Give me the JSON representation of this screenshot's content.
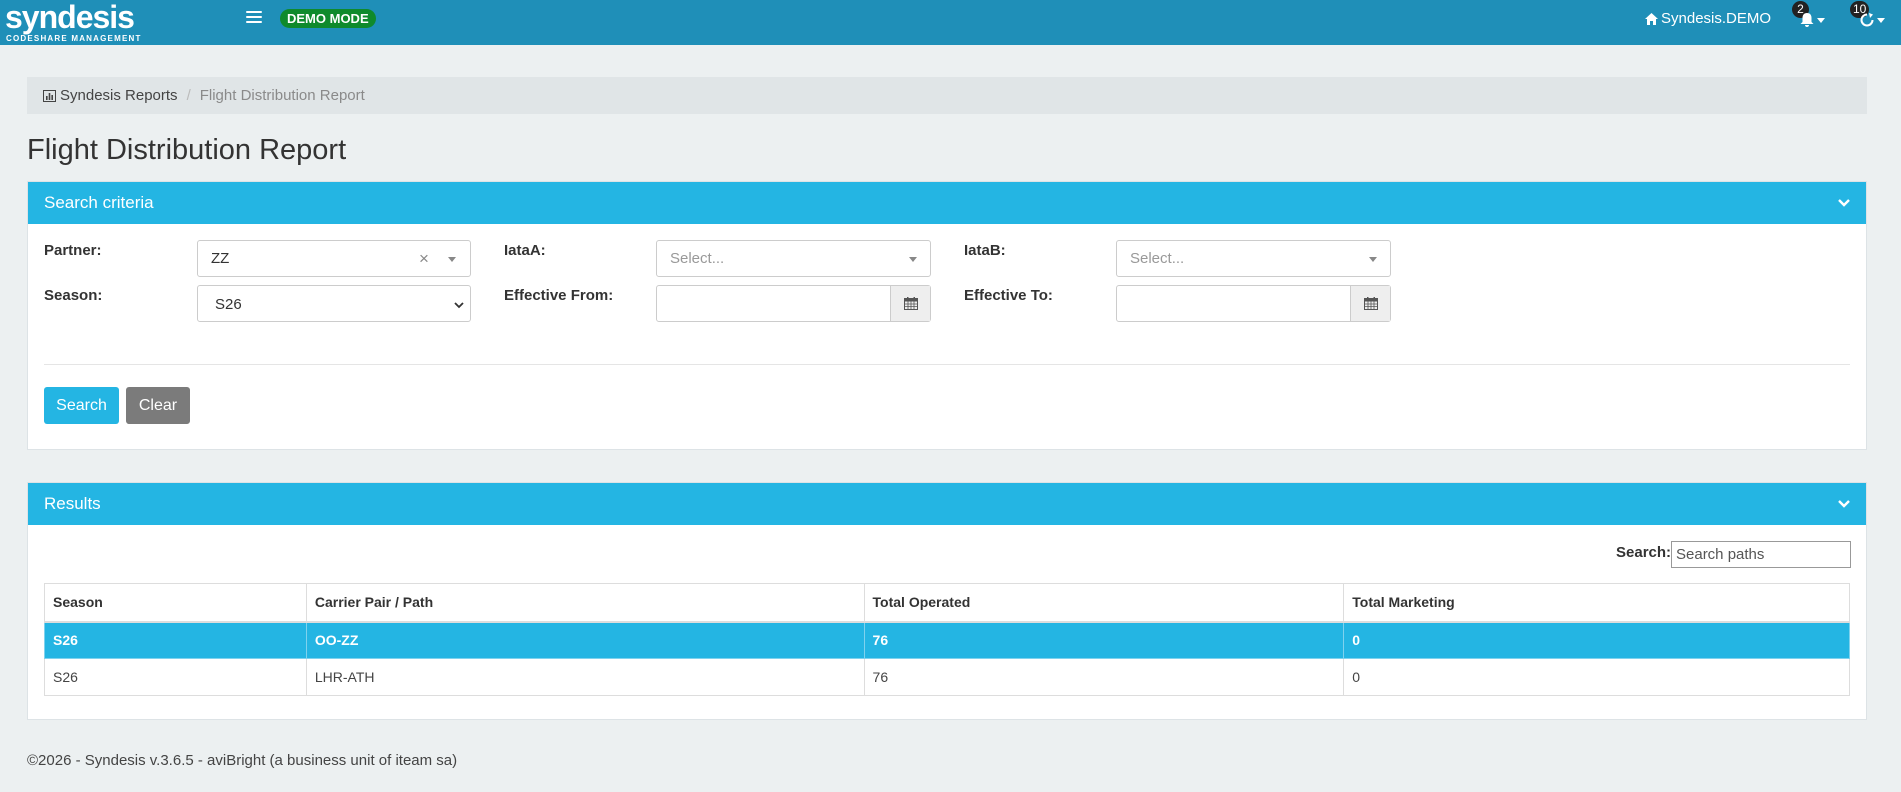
{
  "navbar": {
    "logo_main": "syndesis",
    "logo_sub": "CODESHARE MANAGEMENT",
    "demo_badge": "DEMO MODE",
    "site_label": "Syndesis.DEMO",
    "notifications_count": "2",
    "sync_count": "10",
    "icons": [
      "menu-icon",
      "home-icon",
      "bell-icon",
      "refresh-icon"
    ]
  },
  "breadcrumb": {
    "root": "Syndesis Reports",
    "separator": "/",
    "current": "Flight Distribution Report"
  },
  "page_title": "Flight Distribution Report",
  "search_panel": {
    "title": "Search criteria",
    "partner_label": "Partner:",
    "partner_value": "ZZ",
    "iataA_label": "IataA:",
    "iataA_placeholder": "Select...",
    "iataB_label": "IataB:",
    "iataB_placeholder": "Select...",
    "season_label": "Season:",
    "season_value": "S26",
    "effective_from_label": "Effective From:",
    "effective_from_value": "",
    "effective_to_label": "Effective To:",
    "effective_to_value": "",
    "search_button": "Search",
    "clear_button": "Clear"
  },
  "results_panel": {
    "title": "Results",
    "search_label": "Search:",
    "search_placeholder": "Search paths",
    "columns": [
      "Season",
      "Carrier Pair / Path",
      "Total Operated",
      "Total Marketing"
    ],
    "rows": [
      [
        "S26",
        "OO-ZZ",
        "76",
        "0"
      ],
      [
        "S26",
        "LHR-ATH",
        "76",
        "0"
      ]
    ],
    "selected_row": 0
  },
  "footer": "©2026 - Syndesis v.3.6.5 - aviBright (a business unit of iteam sa)",
  "colors": {
    "navbar": "#1f8fb8",
    "accent": "#24b5e3",
    "demo_badge": "#0f8a2c",
    "clear_button": "#7b7b7b",
    "background": "#ecf0f1"
  }
}
